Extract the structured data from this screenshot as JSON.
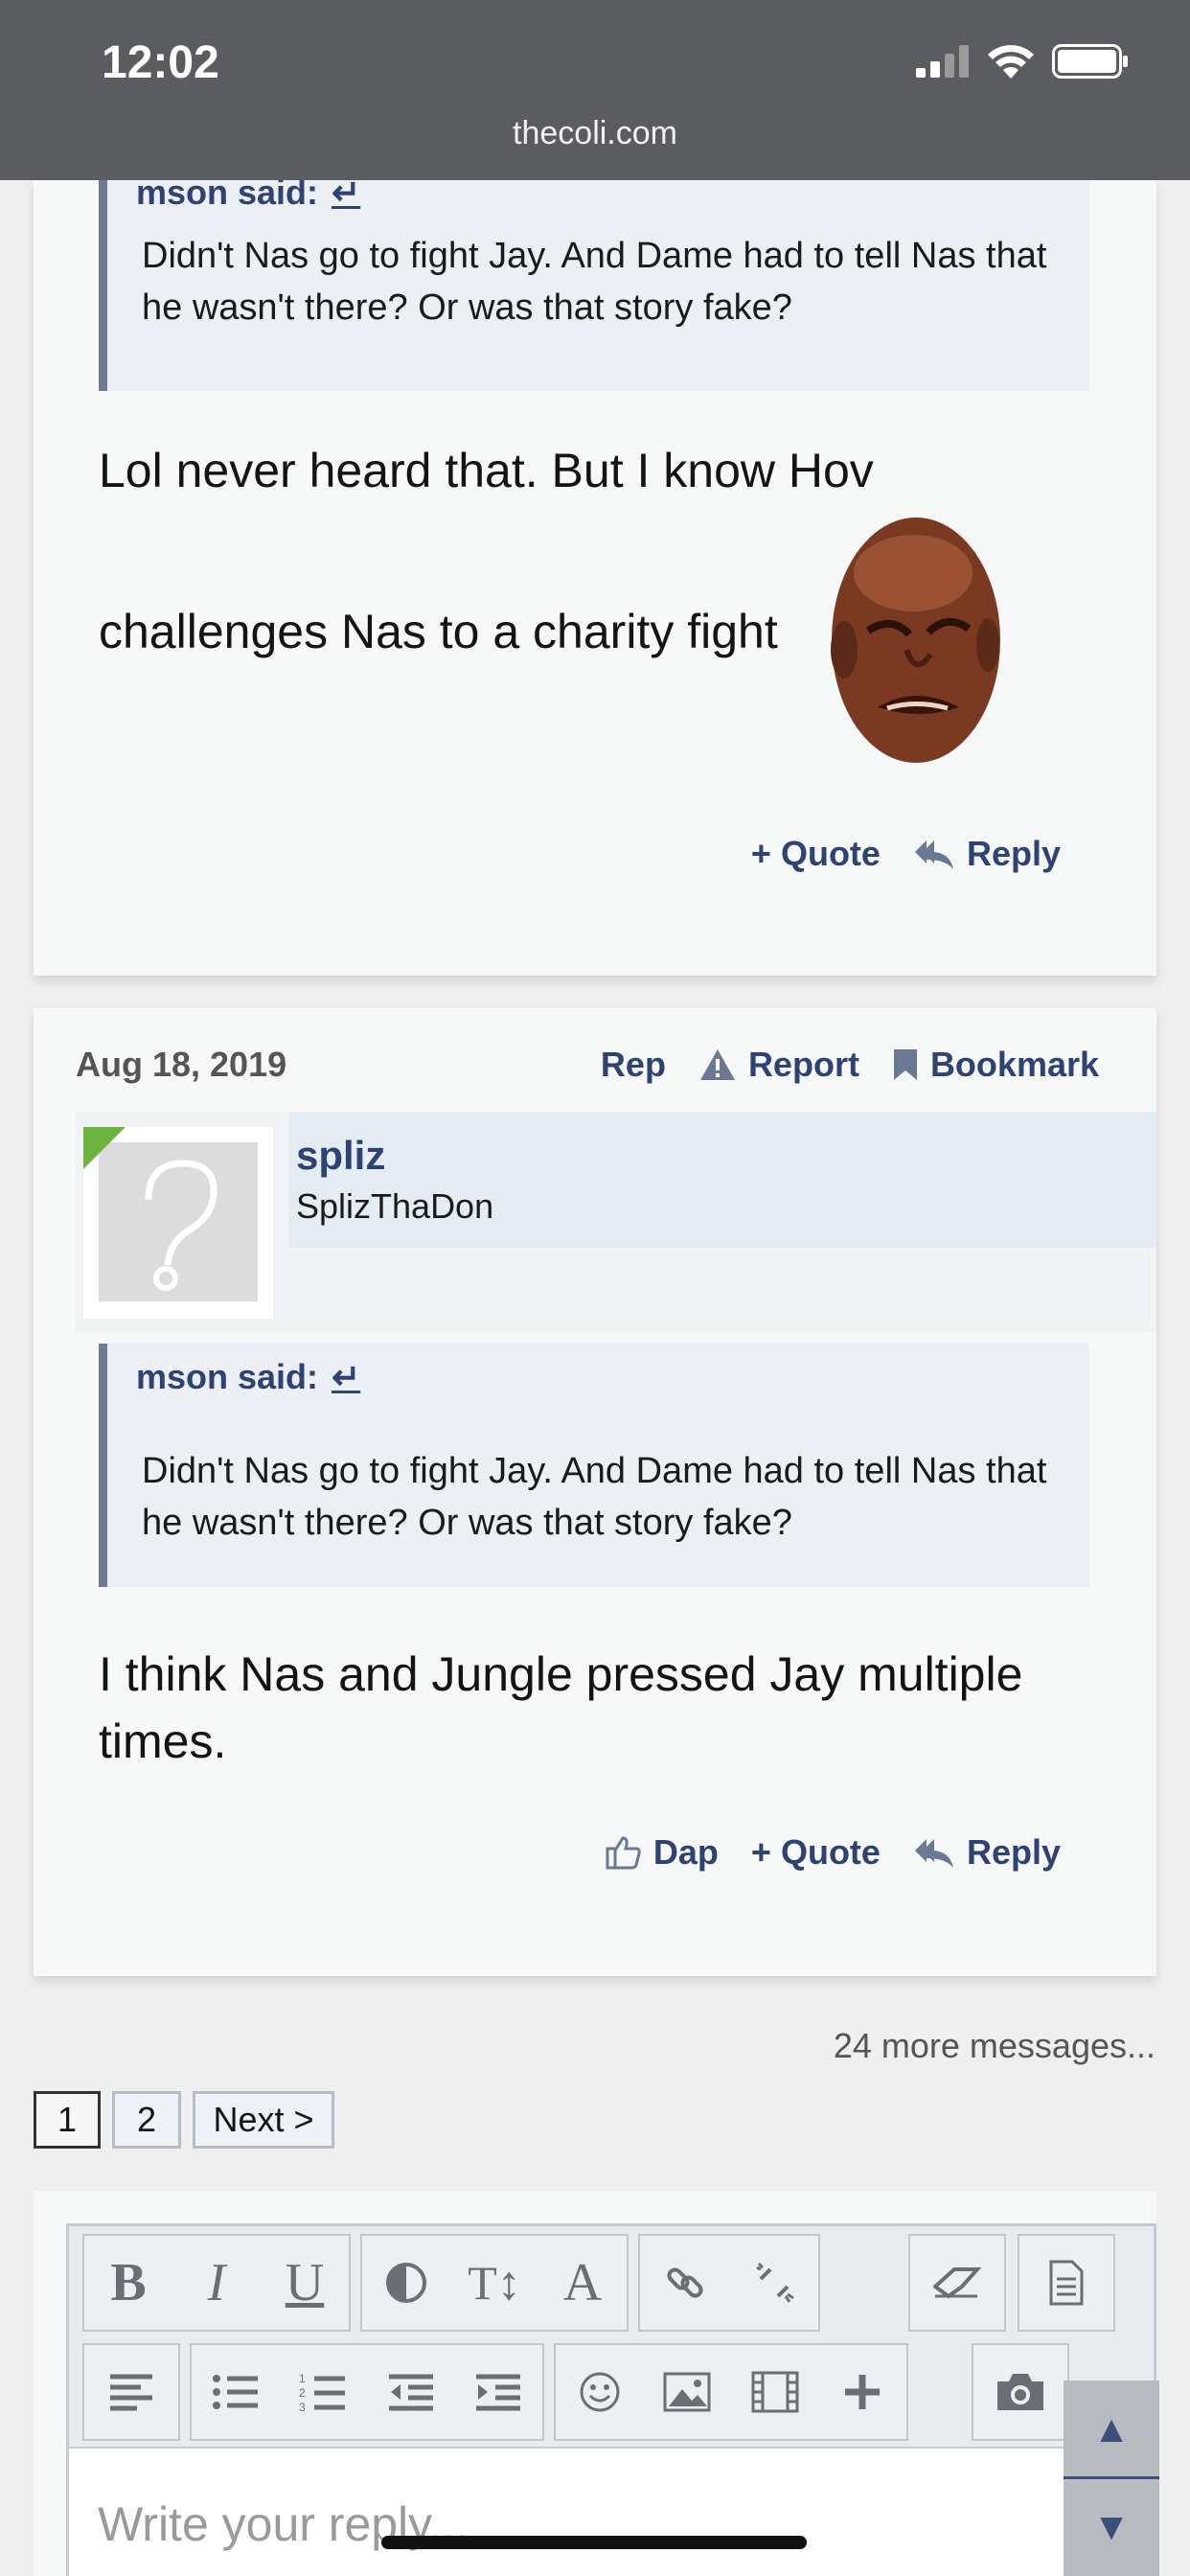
{
  "status_bar": {
    "time": "12:02",
    "url": "thecoli.com"
  },
  "post1": {
    "quote_author": "mson said:",
    "quote_arrow": "↵",
    "quote_text": "Didn't Nas go to fight Jay. And Dame had to tell Nas that he wasn't there? Or was that story fake?",
    "text_line1": "Lol never heard that. But I know Hov",
    "text_line2": "challenges Nas to a charity fight",
    "actions": {
      "quote": "+ Quote",
      "reply": "Reply"
    }
  },
  "post2": {
    "date": "Aug 18, 2019",
    "meta": {
      "rep": "Rep",
      "report": "Report",
      "bookmark": "Bookmark"
    },
    "username": "spliz",
    "user_title": "SplizThaDon",
    "quote_author": "mson said:",
    "quote_arrow": "↵",
    "quote_text": "Didn't Nas go to fight Jay. And Dame had to tell Nas that he wasn't there? Or was that story fake?",
    "text": "I think Nas and Jungle pressed Jay multiple times.",
    "actions": {
      "dap": "Dap",
      "quote": "+ Quote",
      "reply": "Reply"
    }
  },
  "more_messages": "24 more messages...",
  "pagination": {
    "page1": "1",
    "page2": "2",
    "next": "Next >"
  },
  "editor": {
    "toolbar": {
      "bold": "B",
      "italic": "I",
      "underline": "U",
      "text_size": "T↕",
      "font_color": "A"
    },
    "placeholder": "Write your reply..."
  },
  "scroll": {
    "up": "▲",
    "down": "▼"
  },
  "colors": {
    "link": "#2e4374",
    "quote_border": "#6f7b94",
    "quote_bg": "#eceff4",
    "status_bar": "#5a5c60",
    "online_flag": "#6cb33f"
  }
}
